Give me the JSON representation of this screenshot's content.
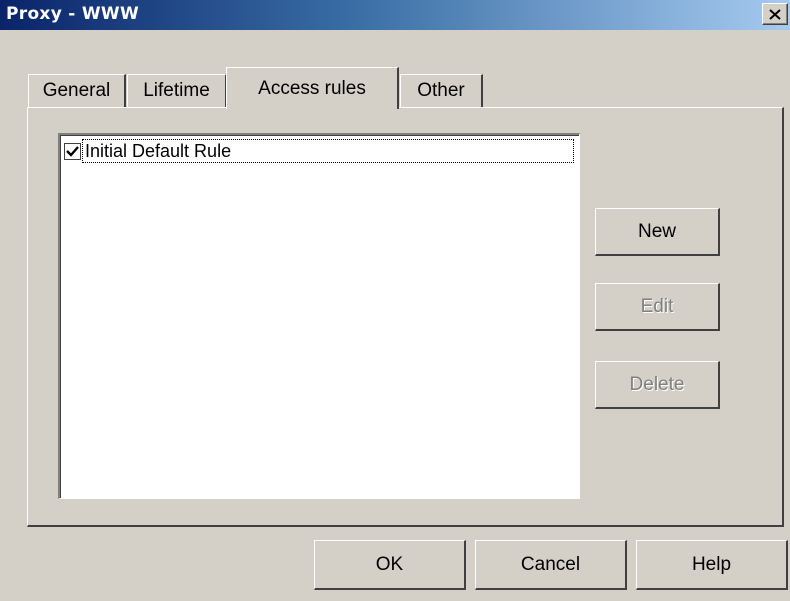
{
  "window": {
    "title": "Proxy - WWW",
    "close_icon": "close-icon"
  },
  "tabs": [
    {
      "label": "General",
      "active": false
    },
    {
      "label": "Lifetime",
      "active": false
    },
    {
      "label": "Access rules",
      "active": true
    },
    {
      "label": "Other",
      "active": false
    }
  ],
  "rules_list": {
    "items": [
      {
        "label": "Initial Default Rule",
        "checked": true
      }
    ]
  },
  "side_buttons": {
    "new_label": "New",
    "edit_label": "Edit",
    "delete_label": "Delete"
  },
  "footer_buttons": {
    "ok_label": "OK",
    "cancel_label": "Cancel",
    "help_label": "Help"
  },
  "colors": {
    "dialog_bg": "#d4d0c8",
    "titlebar_start": "#0a246a",
    "titlebar_end": "#a6caf0",
    "disabled_text": "#808080"
  }
}
